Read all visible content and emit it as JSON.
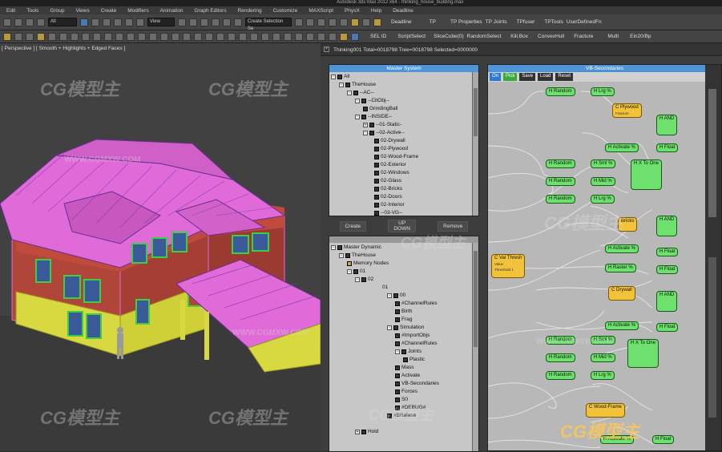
{
  "app_title": "Autodesk 3ds Max 2012 x64 - thinking_house_building.max",
  "menu": [
    "Edit",
    "Tools",
    "Group",
    "Views",
    "Create",
    "Modifiers",
    "Animation",
    "Graph Editors",
    "Rendering",
    "Customize",
    "MAXScript",
    "PhysX",
    "Help",
    "Deadline"
  ],
  "toolbar1": {
    "selection_filter": "All",
    "view_dropdown": "View",
    "named_selection": "Create Selection Se",
    "labels": [
      "Deadline",
      "TP",
      "TP Properties",
      "TP Joints",
      "TPfuser",
      "TPTools",
      "UserDefinedFn"
    ]
  },
  "toolbar2": {
    "labels": [
      "SEL ID",
      "ScriptSelect",
      "SliceCube(0)",
      "RandomSelect",
      "Kill.Box",
      "ConvexHull",
      "Fracture",
      "Multi",
      "Ein20/Bp"
    ]
  },
  "viewport": {
    "label": "[ Perspective ] [ Smooth + Highlights + Edged Faces ]"
  },
  "watermark": {
    "brand": "CG模型主",
    "url": "WWW.CGMXW.COM"
  },
  "thinking_panel": {
    "title": "Thinking001  Total=0018798  Tree=0018798  Selected=0000000",
    "master_system": {
      "header": "Master System",
      "items": [
        "All",
        "TheHouse",
        "--AC--",
        "--CitObj--",
        "GrindingBall",
        "--INSIDE--",
        "--01-Static-",
        "--02-Active--",
        "02-Drywall",
        "02-Plywood",
        "02-Wood-Frame",
        "02-Exterior",
        "02-Windows",
        "02-Glass",
        "02-Bricks",
        "02-Doors",
        "02-Interior",
        "--03-VG--"
      ]
    },
    "buttons": {
      "create": "Create",
      "up": "UP",
      "down": "DOWN",
      "remove": "Remove"
    },
    "master_dynamic": {
      "items": [
        "Master Dynamic",
        "TheHouse",
        "Memory Nodes",
        "01",
        "02",
        "01",
        "00",
        "#ChannelRules",
        "Birth",
        "Frag",
        "Simulation",
        "#ImportObjs",
        "#ChannelRules",
        "Joints",
        "Plastic",
        "Mass",
        "Activate",
        "VB-Secondaries",
        "Forces",
        "S0",
        "#DEBUG#",
        "#BRelese",
        "Hold"
      ]
    }
  },
  "vb_editor": {
    "header": "VB-Secondaries",
    "tools": [
      "On",
      "Pick",
      "Save",
      "Load",
      "Reset"
    ],
    "nodes": [
      "H Random",
      "H Lrg %",
      "C Plywood",
      "Fracture",
      "H AND",
      "H Activate %",
      "H Float",
      "H Random",
      "H Sml %",
      "H X To One",
      "H Random",
      "H Mid %",
      "H Random",
      "H Lrg %",
      "Bricks",
      "H AND",
      "C Val Thresh",
      "Value",
      "Threshold 1",
      "H Activate %",
      "H Float",
      "H Raster %",
      "H Float",
      "C Drywall",
      "H AND",
      "H Activate %",
      "H Float",
      "H Random",
      "H Sml %",
      "H X To One",
      "H Random",
      "H Mid %",
      "H Random",
      "H Lrg %",
      "C Wood-Frame",
      "H Activate %",
      "H Float"
    ]
  },
  "colors": {
    "node_green": "#6ee06e",
    "node_yellow": "#f2c33a",
    "header_blue": "#4f94d8",
    "mesh_pink": "#e06ad8",
    "mesh_yellow": "#d8d840",
    "brick": "#b0463a"
  }
}
